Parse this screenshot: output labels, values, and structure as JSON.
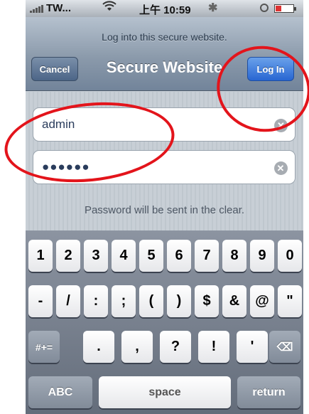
{
  "status": {
    "carrier": "TW...",
    "time": "上午 10:59",
    "spinner_glyph": "✱"
  },
  "nav": {
    "prompt": "Log into this secure website.",
    "title": "Secure Website",
    "cancel_label": "Cancel",
    "login_label": "Log In"
  },
  "form": {
    "username_value": "admin",
    "password_mask": "●●●●●●",
    "clear_glyph": "✕",
    "warning": "Password will be sent in the clear."
  },
  "keyboard": {
    "row1": [
      "1",
      "2",
      "3",
      "4",
      "5",
      "6",
      "7",
      "8",
      "9",
      "0"
    ],
    "row2": [
      "-",
      "/",
      ":",
      ";",
      "(",
      ")",
      "$",
      "&",
      "@",
      "\""
    ],
    "row3": {
      "symbols_label": "#+=",
      "keys": [
        ".",
        ",",
        "?",
        "!",
        "'"
      ],
      "backspace_glyph": "⌫"
    },
    "row4": {
      "abc_label": "ABC",
      "space_label": "space",
      "return_label": "return"
    }
  },
  "annotations": {
    "circle_color": "#e3141b"
  }
}
